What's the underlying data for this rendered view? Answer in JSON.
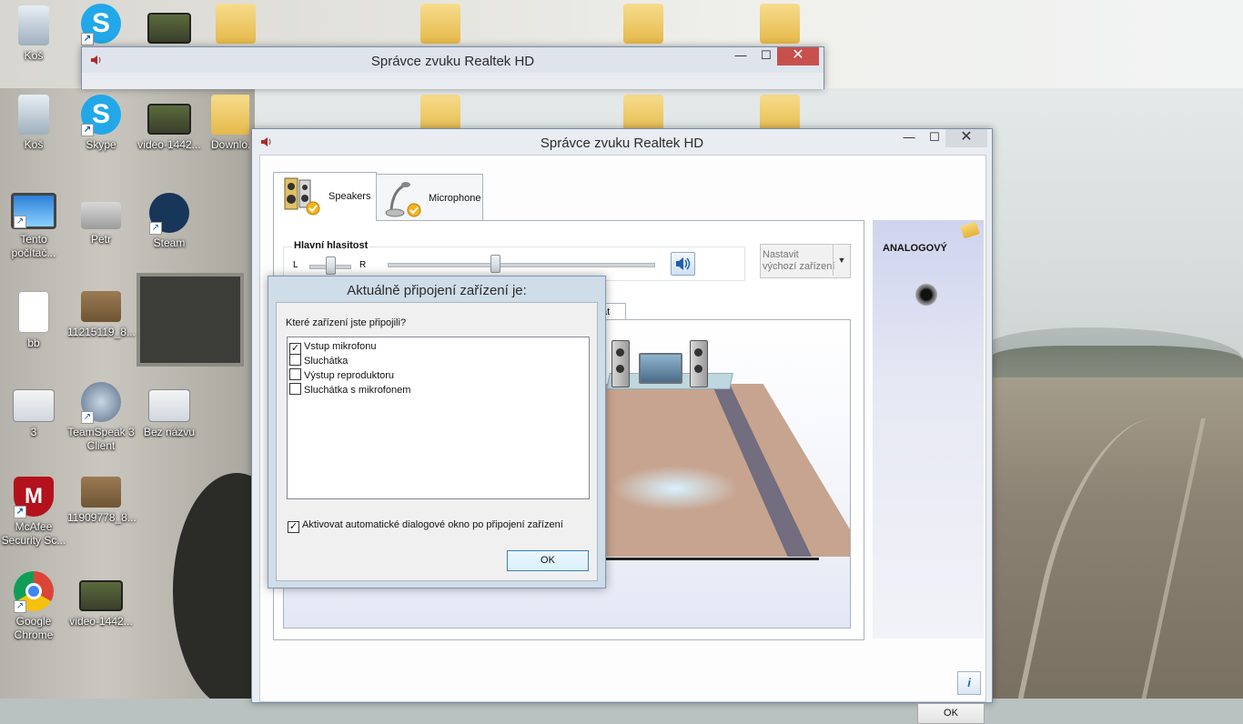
{
  "desktop": {
    "icons": [
      {
        "label": "Koš",
        "icon": "recycle-bin-icon"
      },
      {
        "label": "Skype",
        "icon": "skype-icon"
      },
      {
        "label": "video-1442...",
        "icon": "video-file-icon"
      },
      {
        "label": "Downlo...",
        "icon": "downloads-folder-icon"
      },
      {
        "label": "Tento počítač...",
        "icon": "this-pc-icon"
      },
      {
        "label": "Petr",
        "icon": "user-folder-icon"
      },
      {
        "label": "Steam",
        "icon": "steam-icon"
      },
      {
        "label": "bb",
        "icon": "text-document-icon"
      },
      {
        "label": "11215119_8...",
        "icon": "image-file-icon"
      },
      {
        "label": "3",
        "icon": "screenshot-file-icon"
      },
      {
        "label": "TeamSpeak 3 Client",
        "icon": "teamspeak-icon"
      },
      {
        "label": "Bez názvu",
        "icon": "image-file-icon"
      },
      {
        "label": "McAfee Security Sc...",
        "icon": "mcafee-icon"
      },
      {
        "label": "11909778_8...",
        "icon": "image-file-icon"
      },
      {
        "label": "Google Chrome",
        "icon": "chrome-icon"
      },
      {
        "label": "video-1442...",
        "icon": "video-file-icon"
      }
    ]
  },
  "back_window": {
    "title": "Správce zvuku Realtek HD",
    "minimize": "—",
    "maximize": "☐",
    "close": "✕"
  },
  "main_window": {
    "title": "Správce zvuku Realtek HD",
    "minimize": "—",
    "maximize": "☐",
    "close": "✕",
    "tabs": [
      {
        "label": "Speakers",
        "icon": "speakers-icon",
        "active": true
      },
      {
        "label": "Microphone",
        "icon": "microphone-icon",
        "active": false
      }
    ],
    "volume": {
      "title": "Hlavní hlasitost",
      "left": "L",
      "right": "R",
      "balance": 0.5,
      "level": 0.4
    },
    "set_default": {
      "line1": "Nastavit",
      "line2": "výchozí zařízení"
    },
    "subtab_partial": "át",
    "side": {
      "label": "ANALOGOVÝ"
    },
    "info_button": "i",
    "ok": "OK"
  },
  "dialog": {
    "title": "Aktuálně připojení zařízení je:",
    "question": "Které zařízení jste připojili?",
    "options": [
      {
        "label": "Vstup mikrofonu",
        "checked": true
      },
      {
        "label": "Sluchátka",
        "checked": false
      },
      {
        "label": "Výstup reproduktoru",
        "checked": false
      },
      {
        "label": "Sluchátka s mikrofonem",
        "checked": false
      }
    ],
    "auto_popup": {
      "label": "Aktivovat automatické dialogové okno po připojení zařízení",
      "checked": true
    },
    "ok": "OK"
  },
  "colors": {
    "close_red": "#c7504d",
    "accent_blue": "#3c7fb1"
  }
}
